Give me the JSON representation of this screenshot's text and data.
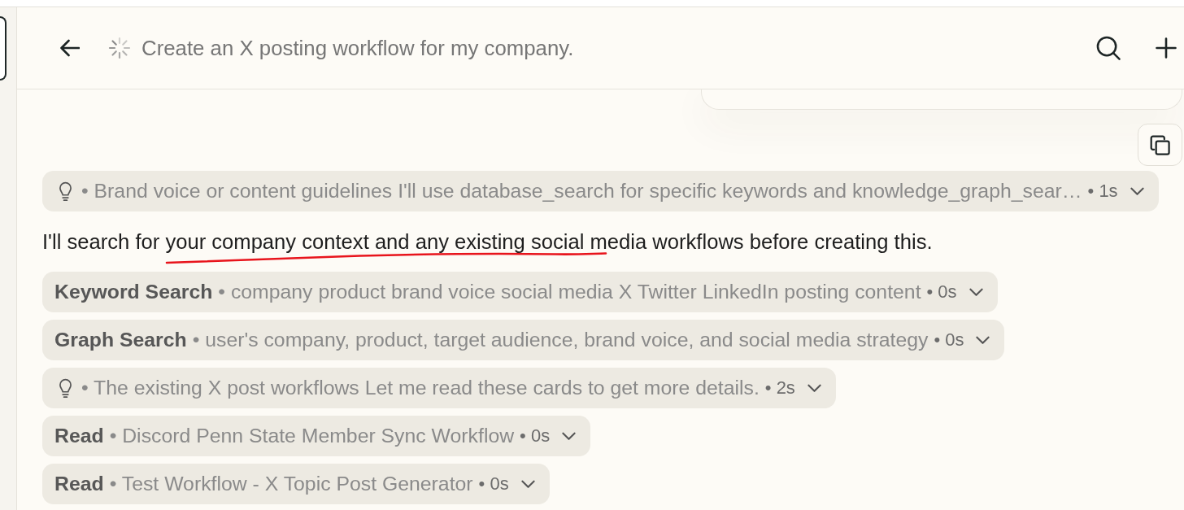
{
  "header": {
    "title": "Create an X posting workflow for my company.",
    "in_progress": true
  },
  "transcript": [
    {
      "kind": "thought",
      "detail": "• Brand voice or content guidelines I'll use database_search for specific keywords and knowledge_graph_sear…",
      "duration": "• 1s",
      "expanded": false
    },
    {
      "kind": "text",
      "text": "I'll search for your company context and any existing social media workflows before creating this.",
      "annotated": true
    },
    {
      "kind": "tool",
      "label": "Keyword Search",
      "detail": "• company product brand voice social media X Twitter LinkedIn posting content",
      "duration": "• 0s",
      "expanded": false
    },
    {
      "kind": "tool",
      "label": "Graph Search",
      "detail": "• user's company, product, target audience, brand voice, and social media strategy",
      "duration": "• 0s",
      "expanded": false
    },
    {
      "kind": "thought",
      "detail": "• The existing X post workflows Let me read these cards to get more details.",
      "duration": "• 2s",
      "expanded": false
    },
    {
      "kind": "tool",
      "label": "Read",
      "detail": "• Discord Penn State Member Sync Workflow",
      "duration": "• 0s",
      "expanded": false
    },
    {
      "kind": "tool",
      "label": "Read",
      "detail": "• Test Workflow - X Topic Post Generator",
      "duration": "• 0s",
      "expanded": false
    }
  ]
}
